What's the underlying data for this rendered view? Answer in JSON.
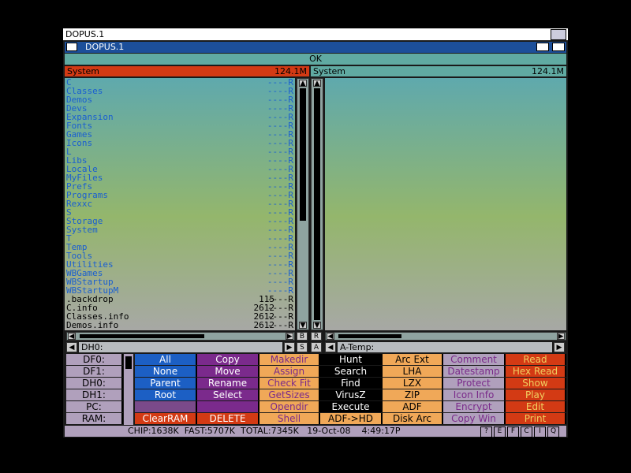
{
  "screen_title": "DOPUS.1",
  "window_title": "DOPUS.1",
  "ok_label": "OK",
  "left": {
    "name": "System",
    "size": "124.1M",
    "entries": [
      {
        "name": "C",
        "size": "",
        "prot": "----R",
        "type": "dir"
      },
      {
        "name": "Classes",
        "size": "",
        "prot": "----R",
        "type": "dir"
      },
      {
        "name": "Demos",
        "size": "",
        "prot": "----R",
        "type": "dir"
      },
      {
        "name": "Devs",
        "size": "",
        "prot": "----R",
        "type": "dir"
      },
      {
        "name": "Expansion",
        "size": "",
        "prot": "----R",
        "type": "dir"
      },
      {
        "name": "Fonts",
        "size": "",
        "prot": "----R",
        "type": "dir"
      },
      {
        "name": "Games",
        "size": "",
        "prot": "----R",
        "type": "dir"
      },
      {
        "name": "Icons",
        "size": "",
        "prot": "----R",
        "type": "dir"
      },
      {
        "name": "L",
        "size": "",
        "prot": "----R",
        "type": "dir"
      },
      {
        "name": "Libs",
        "size": "",
        "prot": "----R",
        "type": "dir"
      },
      {
        "name": "Locale",
        "size": "",
        "prot": "----R",
        "type": "dir"
      },
      {
        "name": "MyFiles",
        "size": "",
        "prot": "----R",
        "type": "dir"
      },
      {
        "name": "Prefs",
        "size": "",
        "prot": "----R",
        "type": "dir"
      },
      {
        "name": "Programs",
        "size": "",
        "prot": "----R",
        "type": "dir"
      },
      {
        "name": "Rexxc",
        "size": "",
        "prot": "----R",
        "type": "dir"
      },
      {
        "name": "S",
        "size": "",
        "prot": "----R",
        "type": "dir"
      },
      {
        "name": "Storage",
        "size": "",
        "prot": "----R",
        "type": "dir"
      },
      {
        "name": "System",
        "size": "",
        "prot": "----R",
        "type": "dir"
      },
      {
        "name": "T",
        "size": "",
        "prot": "----R",
        "type": "dir"
      },
      {
        "name": "Temp",
        "size": "",
        "prot": "----R",
        "type": "dir"
      },
      {
        "name": "Tools",
        "size": "",
        "prot": "----R",
        "type": "dir"
      },
      {
        "name": "Utilities",
        "size": "",
        "prot": "----R",
        "type": "dir"
      },
      {
        "name": "WBGames",
        "size": "",
        "prot": "----R",
        "type": "dir"
      },
      {
        "name": "WBStartup",
        "size": "",
        "prot": "----R",
        "type": "dir"
      },
      {
        "name": "WBStartupM",
        "size": "",
        "prot": "----R",
        "type": "dir"
      },
      {
        "name": ".backdrop",
        "size": "115",
        "prot": "----R",
        "type": "file"
      },
      {
        "name": "C.info",
        "size": "2612",
        "prot": "----R",
        "type": "file"
      },
      {
        "name": "Classes.info",
        "size": "2612",
        "prot": "----R",
        "type": "file"
      },
      {
        "name": "Demos.info",
        "size": "2612",
        "prot": "----R",
        "type": "file"
      }
    ],
    "path": "DH0:"
  },
  "right": {
    "name": "System",
    "size": "124.1M",
    "path": "A-Temp:"
  },
  "mid_labels": {
    "b": "B",
    "r": "R",
    "s": "S",
    "a": "A"
  },
  "drives": [
    "DF0:",
    "DF1:",
    "DH0:",
    "DH1:",
    "PC:",
    "RAM:"
  ],
  "buttons": [
    {
      "col": 0,
      "label": "All",
      "bg": "#1c5fc4",
      "fg": "#fff"
    },
    {
      "col": 0,
      "label": "None",
      "bg": "#1c5fc4",
      "fg": "#fff"
    },
    {
      "col": 0,
      "label": "Parent",
      "bg": "#1c5fc4",
      "fg": "#fff"
    },
    {
      "col": 0,
      "label": "Root",
      "bg": "#1c5fc4",
      "fg": "#fff"
    },
    {
      "col": 0,
      "label": "",
      "bg": "#7a4a8a",
      "fg": "#fff"
    },
    {
      "col": 0,
      "label": "ClearRAM",
      "bg": "#d33a14",
      "fg": "#fff"
    },
    {
      "col": 1,
      "label": "Copy",
      "bg": "#7b2a8c",
      "fg": "#fff"
    },
    {
      "col": 1,
      "label": "Move",
      "bg": "#7b2a8c",
      "fg": "#fff"
    },
    {
      "col": 1,
      "label": "Rename",
      "bg": "#7b2a8c",
      "fg": "#fff"
    },
    {
      "col": 1,
      "label": "Select",
      "bg": "#7b2a8c",
      "fg": "#fff"
    },
    {
      "col": 1,
      "label": "",
      "bg": "#7b2a8c",
      "fg": "#fff"
    },
    {
      "col": 1,
      "label": "DELETE",
      "bg": "#d33a14",
      "fg": "#fff"
    },
    {
      "col": 2,
      "label": "Makedir",
      "bg": "#f0a858",
      "fg": "#7a2a8a"
    },
    {
      "col": 2,
      "label": "Assign",
      "bg": "#f0a858",
      "fg": "#7a2a8a"
    },
    {
      "col": 2,
      "label": "Check Fit",
      "bg": "#f0a858",
      "fg": "#7a2a8a"
    },
    {
      "col": 2,
      "label": "GetSizes",
      "bg": "#f0a858",
      "fg": "#7a2a8a"
    },
    {
      "col": 2,
      "label": "Opendir",
      "bg": "#f0a858",
      "fg": "#7a2a8a"
    },
    {
      "col": 2,
      "label": "Shell",
      "bg": "#f0a858",
      "fg": "#7a2a8a"
    },
    {
      "col": 3,
      "label": "Hunt",
      "bg": "#000",
      "fg": "#fff"
    },
    {
      "col": 3,
      "label": "Search",
      "bg": "#000",
      "fg": "#fff"
    },
    {
      "col": 3,
      "label": "Find",
      "bg": "#000",
      "fg": "#fff"
    },
    {
      "col": 3,
      "label": "VirusZ",
      "bg": "#000",
      "fg": "#fff"
    },
    {
      "col": 3,
      "label": "Execute",
      "bg": "#000",
      "fg": "#fff"
    },
    {
      "col": 3,
      "label": "ADF->HD",
      "bg": "#f0a858",
      "fg": "#000"
    },
    {
      "col": 4,
      "label": "Arc Ext",
      "bg": "#f0a858",
      "fg": "#000"
    },
    {
      "col": 4,
      "label": "LHA",
      "bg": "#f0a858",
      "fg": "#000"
    },
    {
      "col": 4,
      "label": "LZX",
      "bg": "#f0a858",
      "fg": "#000"
    },
    {
      "col": 4,
      "label": "ZIP",
      "bg": "#f0a858",
      "fg": "#000"
    },
    {
      "col": 4,
      "label": "ADF",
      "bg": "#f0a858",
      "fg": "#000"
    },
    {
      "col": 4,
      "label": "Disk Arc",
      "bg": "#f0a858",
      "fg": "#000"
    },
    {
      "col": 5,
      "label": "Comment",
      "bg": "#b0a0bc",
      "fg": "#7a2a8a"
    },
    {
      "col": 5,
      "label": "Datestamp",
      "bg": "#b0a0bc",
      "fg": "#7a2a8a"
    },
    {
      "col": 5,
      "label": "Protect",
      "bg": "#b0a0bc",
      "fg": "#7a2a8a"
    },
    {
      "col": 5,
      "label": "Icon Info",
      "bg": "#b0a0bc",
      "fg": "#7a2a8a"
    },
    {
      "col": 5,
      "label": "Encrypt",
      "bg": "#b0a0bc",
      "fg": "#7a2a8a"
    },
    {
      "col": 5,
      "label": "Copy Win",
      "bg": "#b0a0bc",
      "fg": "#7a2a8a"
    },
    {
      "col": 6,
      "label": "Read",
      "bg": "#d33a14",
      "fg": "#f0d060"
    },
    {
      "col": 6,
      "label": "Hex Read",
      "bg": "#d33a14",
      "fg": "#f0d060"
    },
    {
      "col": 6,
      "label": "Show",
      "bg": "#d33a14",
      "fg": "#f0d060"
    },
    {
      "col": 6,
      "label": "Play",
      "bg": "#d33a14",
      "fg": "#f0d060"
    },
    {
      "col": 6,
      "label": "Edit",
      "bg": "#d33a14",
      "fg": "#f0d060"
    },
    {
      "col": 6,
      "label": "Print",
      "bg": "#d33a14",
      "fg": "#f0d060"
    }
  ],
  "status_text": "CHIP:1638K  FAST:5707K  TOTAL:7345K   19-Oct-08    4:49:17P",
  "status_buttons": [
    "?",
    "E",
    "F",
    "C",
    "I",
    "Q"
  ],
  "colors": {
    "active_header": "#d33a14",
    "inactive_header": "#60aaa2",
    "dir_text": "#1a5fd0"
  }
}
